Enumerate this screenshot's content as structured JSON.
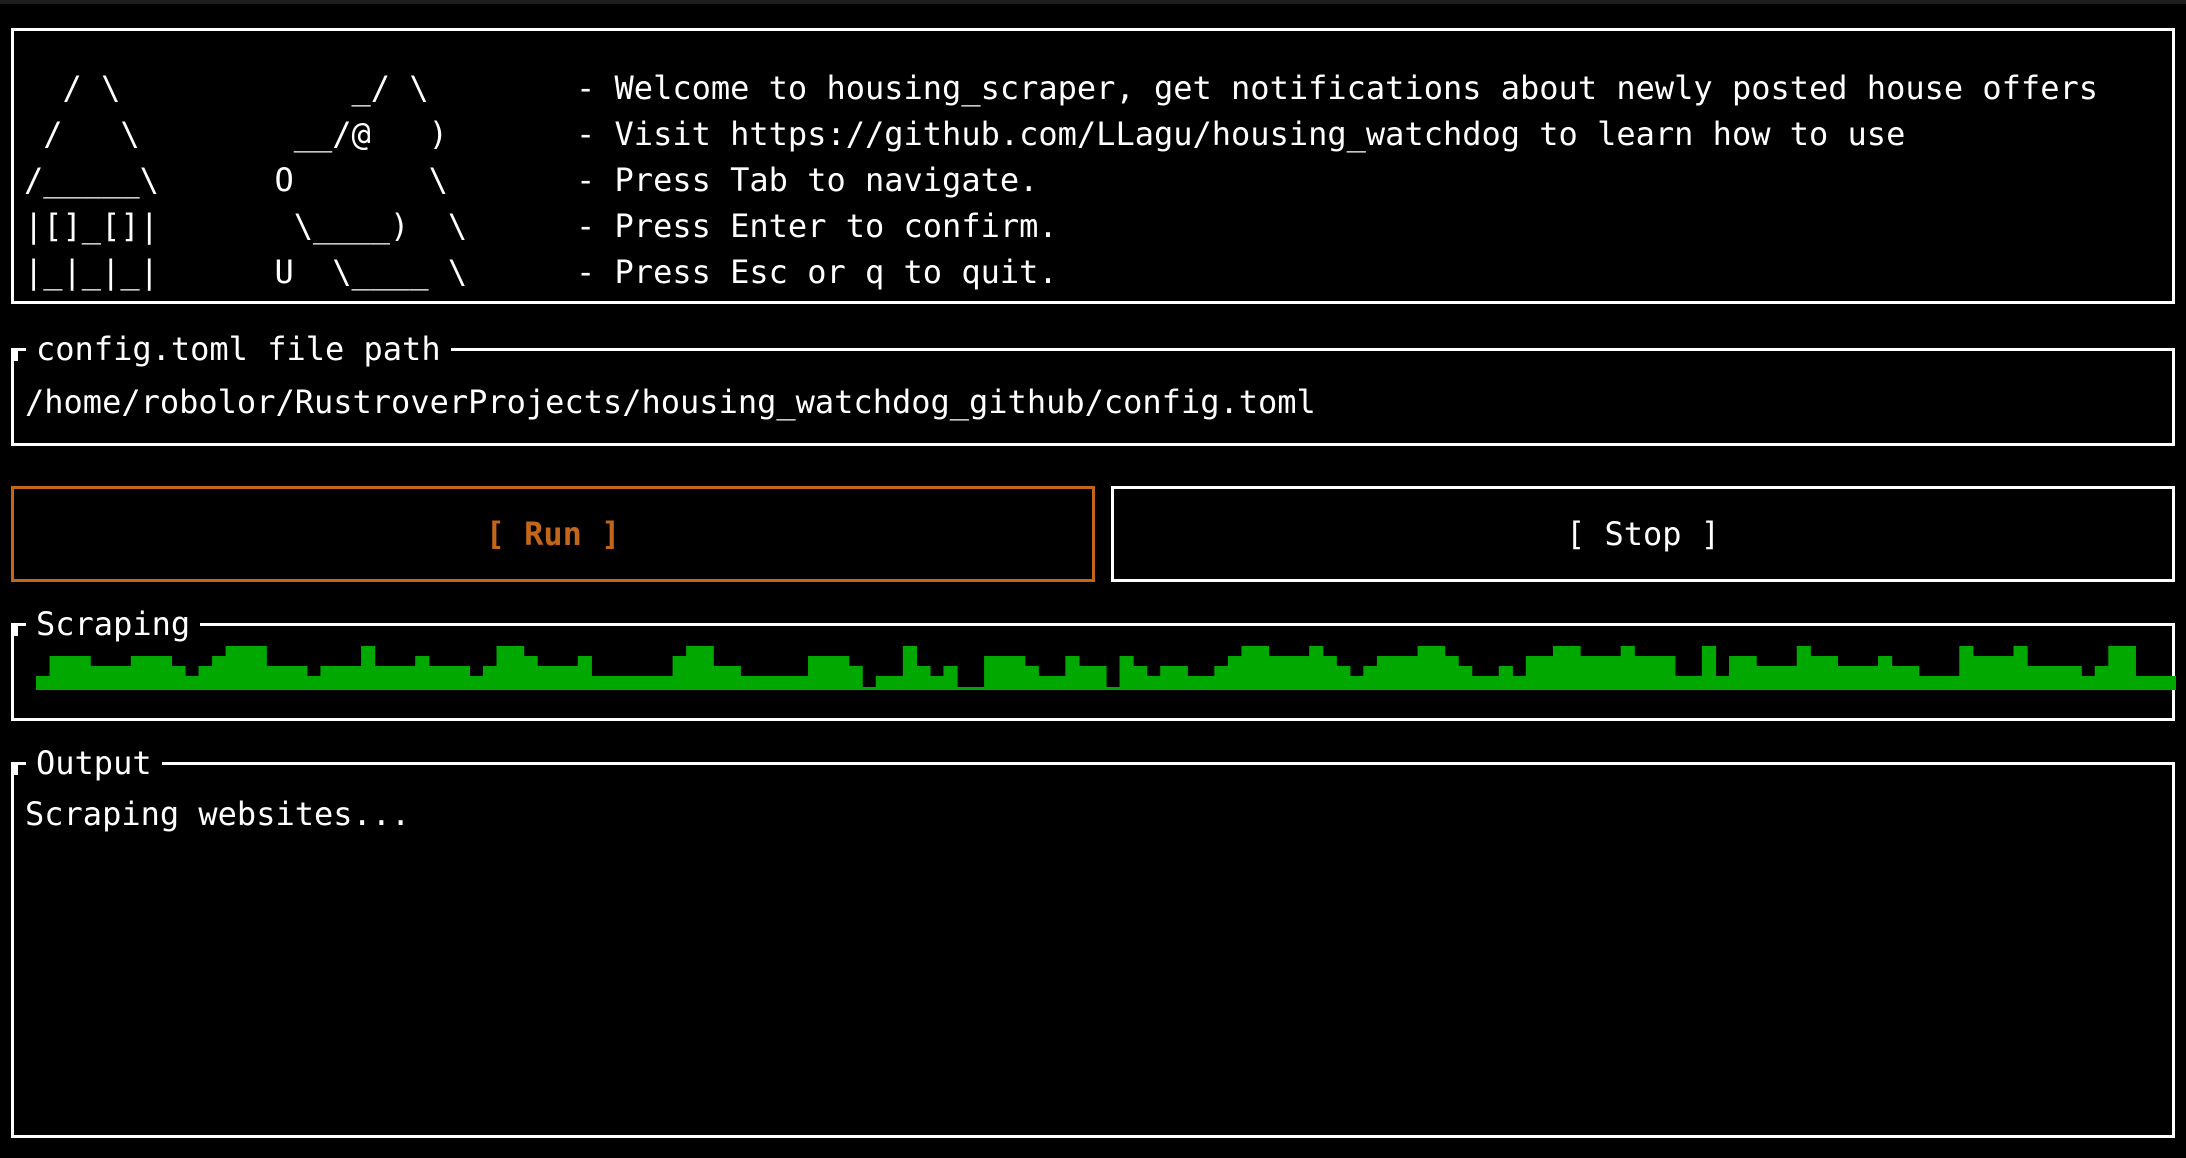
{
  "header": {
    "art_lines": [
      "  / \\            _/ \\",
      " /   \\        __/@   )",
      "/_____\\      O       \\",
      "|[]_[]|       \\____)  \\",
      "|_|_|_|      U  \\____ \\"
    ],
    "help_lines": [
      "- Welcome to housing_scraper, get notifications about newly posted house offers",
      "- Visit https://github.com/LLagu/housing_watchdog to learn how to use",
      "- Press Tab to navigate.",
      "- Press Enter to confirm.",
      "- Press Esc or q to quit."
    ]
  },
  "config": {
    "title": "config.toml file path",
    "path": "/home/robolor/RustroverProjects/housing_watchdog_github/config.toml"
  },
  "buttons": {
    "run_label": "[ Run ]",
    "stop_label": "[ Stop ]"
  },
  "scraping": {
    "title": "Scraping",
    "bar_color": "#00a800",
    "levels": [
      1,
      3,
      3,
      3,
      2,
      2,
      2,
      3,
      3,
      3,
      2,
      1,
      2,
      3,
      4,
      4,
      4,
      2,
      2,
      2,
      1,
      2,
      2,
      2,
      4,
      2,
      2,
      2,
      3,
      2,
      2,
      2,
      1,
      2,
      4,
      4,
      3,
      2,
      2,
      2,
      3,
      1,
      1,
      1,
      1,
      1,
      1,
      3,
      4,
      4,
      2,
      2,
      1,
      1,
      1,
      1,
      1,
      3,
      3,
      3,
      2,
      0,
      1,
      1,
      4,
      2,
      1,
      2,
      0,
      0,
      3,
      3,
      3,
      2,
      1,
      1,
      3,
      2,
      2,
      0,
      3,
      2,
      1,
      2,
      2,
      1,
      1,
      2,
      3,
      4,
      4,
      3,
      3,
      3,
      4,
      3,
      2,
      1,
      2,
      3,
      3,
      3,
      4,
      4,
      3,
      2,
      1,
      1,
      2,
      1,
      3,
      3,
      4,
      4,
      3,
      3,
      3,
      4,
      3,
      3,
      3,
      1,
      1,
      4,
      1,
      3,
      3,
      2,
      2,
      2,
      4,
      3,
      3,
      2,
      2,
      2,
      3,
      2,
      2,
      1,
      1,
      1,
      4,
      3,
      3,
      3,
      4,
      2,
      2,
      2,
      2,
      1,
      2,
      4,
      4,
      1,
      1,
      1
    ]
  },
  "output": {
    "title": "Output",
    "lines": [
      "Scraping websites..."
    ]
  },
  "colors": {
    "accent": "#c2661a",
    "border": "#ffffff",
    "background": "#000000"
  }
}
